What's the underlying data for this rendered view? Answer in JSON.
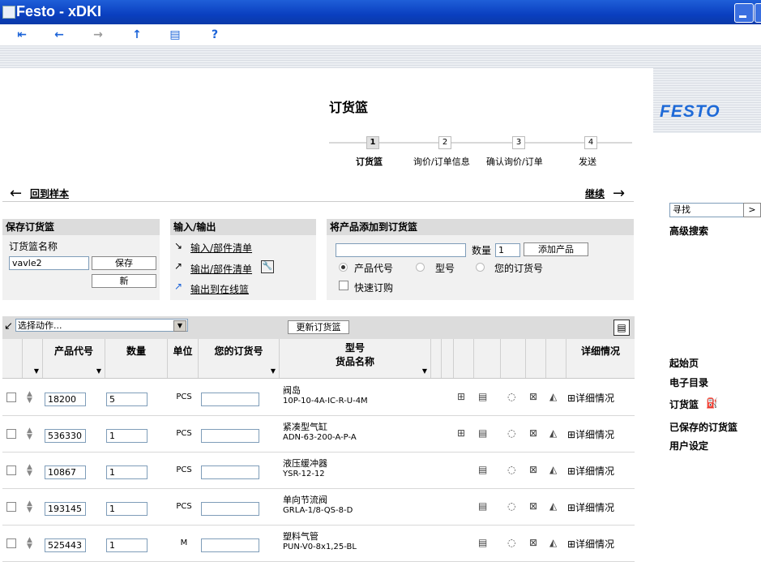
{
  "window": {
    "title": "Festo - xDKI"
  },
  "brand": {
    "logo": "FESTO",
    "accent": "#1e6ad8"
  },
  "toolbar": {
    "icons": [
      "first-icon",
      "back-icon",
      "forward-icon",
      "up-icon",
      "print-icon",
      "help-icon"
    ],
    "help_glyph": "?"
  },
  "page": {
    "title": "订货篮"
  },
  "steps": [
    {
      "num": "1",
      "label": "订货篮"
    },
    {
      "num": "2",
      "label": "询价/订单信息"
    },
    {
      "num": "3",
      "label": "确认询价/订单"
    },
    {
      "num": "4",
      "label": "发送"
    }
  ],
  "nav": {
    "back": "回到样本",
    "next": "继续"
  },
  "save_panel": {
    "header": "保存订货篮",
    "name_label": "订货篮名称",
    "name_value": "vavle2",
    "save": "保存",
    "new": "新"
  },
  "io_panel": {
    "header": "输入/输出",
    "import": "输入/部件清单",
    "export": "输出/部件清单",
    "online": "输出到在线篮"
  },
  "add_panel": {
    "header": "将产品添加到订货篮",
    "qty_label": "数量",
    "qty_value": "1",
    "add": "添加产品",
    "opt1": "产品代号",
    "opt2": "型号",
    "opt3": "您的订货号",
    "quick": "快速订购"
  },
  "grid": {
    "action_select": "选择动作...",
    "update": "更新订货篮",
    "headers": {
      "code": "产品代号",
      "qty": "数量",
      "unit": "单位",
      "cust": "您的订货号",
      "model": "型号",
      "name": "货品名称",
      "detail": "详细情况"
    },
    "rows": [
      {
        "code": "18200",
        "qty": "5",
        "unit": "PCS",
        "name": "阀岛",
        "model": "10P-10-4A-IC-R-U-4M",
        "detail": "⊞详细情况"
      },
      {
        "code": "536330",
        "qty": "1",
        "unit": "PCS",
        "name": "紧凑型气缸",
        "model": "ADN-63-200-A-P-A",
        "detail": "⊞详细情况"
      },
      {
        "code": "10867",
        "qty": "1",
        "unit": "PCS",
        "name": "液压缓冲器",
        "model": "YSR-12-12",
        "detail": "⊞详细情况"
      },
      {
        "code": "193145",
        "qty": "1",
        "unit": "PCS",
        "name": "单向节流阀",
        "model": "GRLA-1/8-QS-8-D",
        "detail": "⊞详细情况"
      },
      {
        "code": "525443",
        "qty": "1",
        "unit": "M",
        "name": "塑料气管",
        "model": "PUN-V0-8x1,25-BL",
        "detail": "⊞详细情况"
      }
    ]
  },
  "right": {
    "search_value": "寻找",
    "go": ">",
    "advanced": "高级搜索",
    "links": [
      "起始页",
      "电子目录",
      "订货篮",
      "已保存的订货篮",
      "用户设定"
    ]
  }
}
